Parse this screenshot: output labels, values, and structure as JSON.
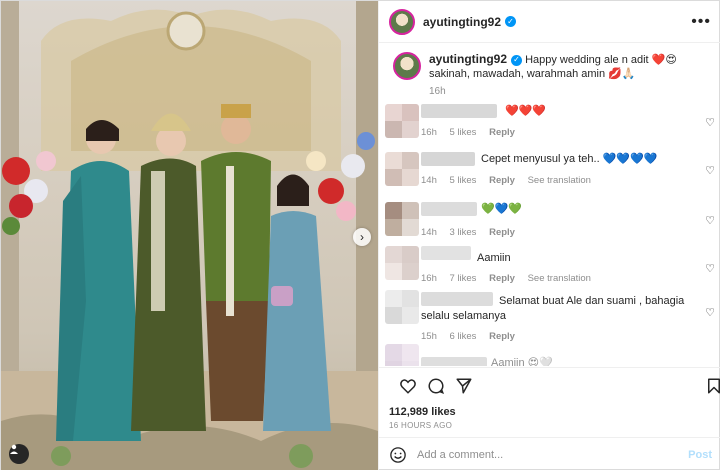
{
  "post": {
    "username": "ayutingting92",
    "more_icon": "more-horizontal-icon",
    "caption_text": "Happy wedding ale n adit ❤️😍 sakinah, mawadah, warahmah amin 💋🙏🏻",
    "caption_time": "16h"
  },
  "comments": [
    {
      "text": "❤️❤️❤️",
      "time": "16h",
      "likes": "5 likes",
      "reply": "Reply",
      "translate": ""
    },
    {
      "text": "Cepet menyusul ya teh.. 💙💙💙💙",
      "time": "14h",
      "likes": "5 likes",
      "reply": "Reply",
      "translate": "See translation"
    },
    {
      "text": "💚💙💚",
      "time": "14h",
      "likes": "3 likes",
      "reply": "Reply",
      "translate": ""
    },
    {
      "text": "Aamiin",
      "time": "16h",
      "likes": "7 likes",
      "reply": "Reply",
      "translate": "See translation"
    },
    {
      "text": "Selamat buat Ale dan suami , bahagia selalu selamanya",
      "time": "15h",
      "likes": "6 likes",
      "reply": "Reply",
      "translate": ""
    },
    {
      "text": "Aamiin 😍🤍",
      "time": "",
      "likes": "",
      "reply": "",
      "translate": ""
    }
  ],
  "actions": {
    "likes": "112,989 likes",
    "time_ago": "16 HOURS AGO"
  },
  "add_comment": {
    "placeholder": "Add a comment...",
    "post_label": "Post"
  },
  "colors": {
    "verified": "#0095f6",
    "post_disabled": "#b2dffc",
    "story_ring": "#d6249f"
  }
}
